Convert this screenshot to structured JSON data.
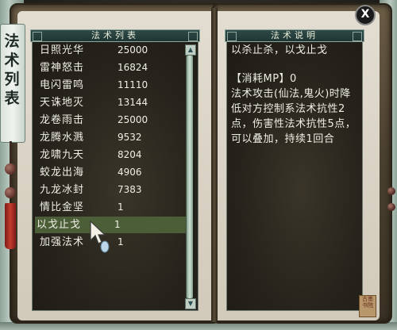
{
  "list_panel": {
    "title": "法术列表",
    "selected_index": 10,
    "spells": [
      {
        "name": "日照光华",
        "value": "25000"
      },
      {
        "name": "雷神怒击",
        "value": "16824"
      },
      {
        "name": "电闪雷鸣",
        "value": "11110"
      },
      {
        "name": "天诛地灭",
        "value": "13144"
      },
      {
        "name": "龙卷雨击",
        "value": "25000"
      },
      {
        "name": "龙腾水溅",
        "value": "9532"
      },
      {
        "name": "龙啸九天",
        "value": "8204"
      },
      {
        "name": "蛟龙出海",
        "value": "4906"
      },
      {
        "name": "九龙冰封",
        "value": "7383"
      },
      {
        "name": "情比金坚",
        "value": "1"
      },
      {
        "name": "以戈止戈",
        "value": "1"
      },
      {
        "name": "加强法术",
        "value": "1"
      }
    ]
  },
  "desc_panel": {
    "title": "法术说明",
    "line1": "以杀止杀，以戈止戈",
    "mp_line": "【消耗MP】0",
    "body": "法术攻击(仙法,鬼火)时降低对方控制系法术抗性2点，伤害性法术抗性5点，可以叠加，持续1回合"
  },
  "side_tab": {
    "label": "法术列表"
  },
  "close_label": "X",
  "seal_text": "古墨书院",
  "colors": {
    "selected_row": "#4b5e37",
    "text": "#efeee4",
    "header": "#1f3533"
  }
}
